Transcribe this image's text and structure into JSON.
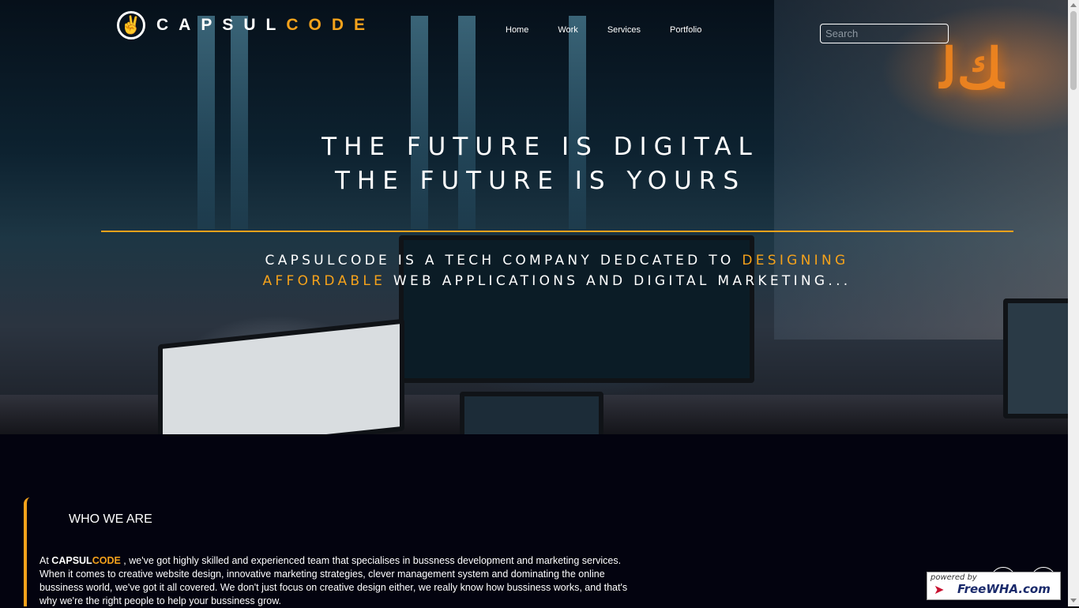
{
  "brand": {
    "icon": "peace-hand-icon",
    "name_part1": "CAPSUL",
    "name_part2": "CODE"
  },
  "nav": {
    "items": [
      "Home",
      "Work",
      "Services",
      "Portfolio"
    ]
  },
  "search": {
    "placeholder": "Search"
  },
  "hero": {
    "line1": "THE FUTURE IS DIGITAL",
    "line2": "THE FUTURE IS YOURS",
    "tagline_part1": "CAPSULCODE IS A TECH COMPANY DEDCATED TO ",
    "tagline_highlight": "DESIGNING AFFORDABLE",
    "tagline_part2": " WEB APPLICATIONS AND DIGITAL MARKETING..."
  },
  "about": {
    "title": "WHO WE ARE",
    "prefix": "At ",
    "brand_a": "CAPSUL",
    "brand_b": "CODE",
    "body": " , we've got highly skilled and experienced team that specialises in bussness development and marketing services. When it comes to creative website design, innovative marketing strategies, clever management system and dominating the online bussiness world, we've got it all covered. We don't just focus on creative design either, we really know how bussiness works, and that's why we're the right people to help your bussiness grow."
  },
  "badge": {
    "small": "powered by",
    "big": "FreeWHA.com"
  },
  "colors": {
    "accent": "#f5a21b",
    "background": "#03030f"
  }
}
